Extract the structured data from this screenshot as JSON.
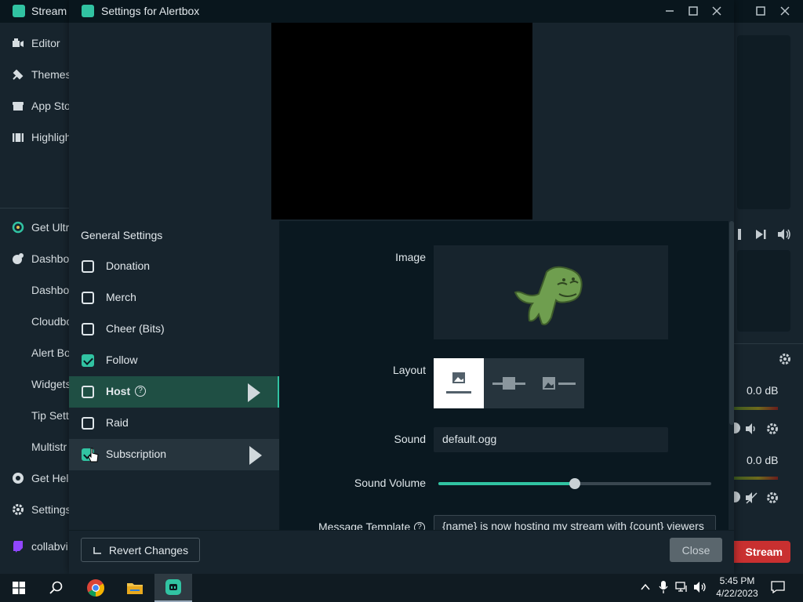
{
  "app": {
    "title": "Stream",
    "nav": [
      "Editor",
      "Themes",
      "App Sto",
      "Highligh"
    ],
    "nav2": [
      "Get Ultr",
      "Dashbo",
      "Dashbo",
      "Cloudbo",
      "Alert Bo",
      "Widgets",
      "Tip Sett",
      "Multistr",
      "Get Hel",
      "Settings",
      "collabvi"
    ],
    "db1": "0.0 dB",
    "db2": "0.0 dB",
    "go_live": "Stream"
  },
  "dialog": {
    "title": "Settings for Alertbox",
    "general_settings": "General Settings",
    "alerts": [
      {
        "label": "Donation",
        "checked": false
      },
      {
        "label": "Merch",
        "checked": false
      },
      {
        "label": "Cheer (Bits)",
        "checked": false
      },
      {
        "label": "Follow",
        "checked": true
      },
      {
        "label": "Host",
        "checked": false
      },
      {
        "label": "Raid",
        "checked": false
      },
      {
        "label": "Subscription",
        "checked": true
      }
    ],
    "host_help": "?",
    "fields": {
      "image_label": "Image",
      "layout_label": "Layout",
      "sound_label": "Sound",
      "sound_value": "default.ogg",
      "volume_label": "Sound Volume",
      "volume_percent": 50,
      "message_label": "Message Template",
      "message_value": "{name} is now hosting my stream with {count} viewers"
    },
    "revert_label": "Revert Changes",
    "close_label": "Close"
  },
  "taskbar": {
    "time": "5:45 PM",
    "date": "4/22/2023"
  },
  "colors": {
    "accent": "#31c3a2",
    "live": "#c93030"
  }
}
